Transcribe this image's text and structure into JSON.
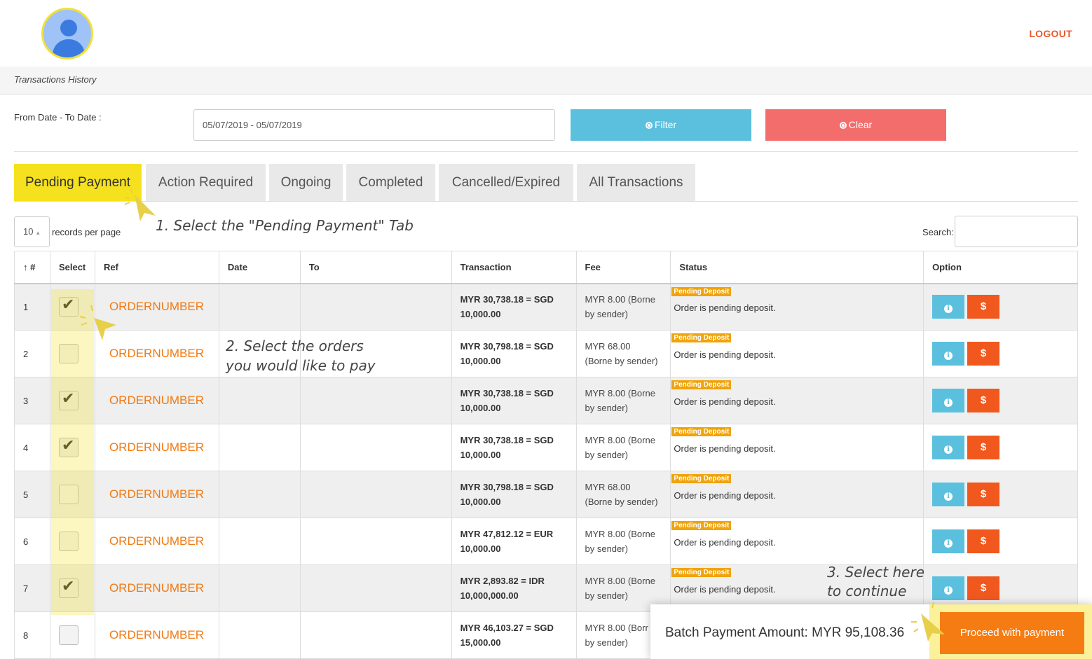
{
  "header": {
    "logout_label": "LOGOUT"
  },
  "breadcrumb": "Transactions History",
  "filter": {
    "label": "From Date - To Date :",
    "date_range": "05/07/2019 - 05/07/2019",
    "filter_label": "Filter",
    "clear_label": "Clear"
  },
  "tabs": [
    {
      "label": "Pending Payment",
      "active": true
    },
    {
      "label": "Action Required"
    },
    {
      "label": "Ongoing"
    },
    {
      "label": "Completed"
    },
    {
      "label": "Cancelled/Expired"
    },
    {
      "label": "All Transactions"
    }
  ],
  "annotations": {
    "step1": "1. Select the \"Pending Payment\" Tab",
    "step2_line1": "2. Select the orders",
    "step2_line2": "you would like to pay",
    "step3_line1": "3. Select here",
    "step3_line2": "to continue"
  },
  "table_controls": {
    "page_length": "10",
    "records_label": "records per page",
    "search_label": "Search:"
  },
  "table": {
    "headers": [
      "↑ #",
      "Select",
      "Ref",
      "Date",
      "To",
      "Transaction",
      "Fee",
      "Status",
      "Option"
    ],
    "rows": [
      {
        "num": "1",
        "checked": true,
        "ref": "ORDERNUMBER",
        "trans1": "MYR 30,738.18 = SGD",
        "trans2": "10,000.00",
        "fee1": "MYR 8.00 (Borne",
        "fee2": "by sender)",
        "badge": "Pending Deposit",
        "status": "Order is pending deposit."
      },
      {
        "num": "2",
        "checked": false,
        "ref": "ORDERNUMBER",
        "trans1": "MYR 30,798.18 = SGD",
        "trans2": "10,000.00",
        "fee1": "MYR 68.00",
        "fee2": "(Borne by sender)",
        "badge": "Pending Deposit",
        "status": "Order is pending deposit."
      },
      {
        "num": "3",
        "checked": true,
        "ref": "ORDERNUMBER",
        "trans1": "MYR 30,738.18 = SGD",
        "trans2": "10,000.00",
        "fee1": "MYR 8.00 (Borne",
        "fee2": "by sender)",
        "badge": "Pending Deposit",
        "status": "Order is pending deposit."
      },
      {
        "num": "4",
        "checked": true,
        "ref": "ORDERNUMBER",
        "trans1": "MYR 30,738.18 = SGD",
        "trans2": "10,000.00",
        "fee1": "MYR 8.00 (Borne",
        "fee2": "by sender)",
        "badge": "Pending Deposit",
        "status": "Order is pending deposit."
      },
      {
        "num": "5",
        "checked": false,
        "ref": "ORDERNUMBER",
        "trans1": "MYR 30,798.18 = SGD",
        "trans2": "10,000.00",
        "fee1": "MYR 68.00",
        "fee2": "(Borne by sender)",
        "badge": "Pending Deposit",
        "status": "Order is pending deposit."
      },
      {
        "num": "6",
        "checked": false,
        "ref": "ORDERNUMBER",
        "trans1": "MYR 47,812.12 = EUR",
        "trans2": "10,000.00",
        "fee1": "MYR 8.00 (Borne",
        "fee2": "by sender)",
        "badge": "Pending Deposit",
        "status": "Order is pending deposit."
      },
      {
        "num": "7",
        "checked": true,
        "ref": "ORDERNUMBER",
        "trans1": "MYR 2,893.82 = IDR",
        "trans2": "10,000,000.00",
        "fee1": "MYR 8.00 (Borne",
        "fee2": "by sender)",
        "badge": "Pending Deposit",
        "status": "Order is pending deposit."
      },
      {
        "num": "8",
        "checked": false,
        "ref": "ORDERNUMBER",
        "trans1": "MYR 46,103.27 = SGD",
        "trans2": "15,000.00",
        "fee1": "MYR 8.00 (Borr",
        "fee2": "by sender)",
        "badge": "",
        "status": ""
      }
    ],
    "info_label": "i",
    "pay_label": "$"
  },
  "batch": {
    "amount_text": "Batch Payment Amount: MYR 95,108.36",
    "proceed_label": "Proceed with payment"
  },
  "colors": {
    "accent_yellow": "#f5e11e",
    "filter_blue": "#5bc0de",
    "clear_red": "#f46d6d",
    "ref_orange": "#f07a13",
    "pay_orange": "#f0581e",
    "badge_orange": "#f0a30a"
  }
}
